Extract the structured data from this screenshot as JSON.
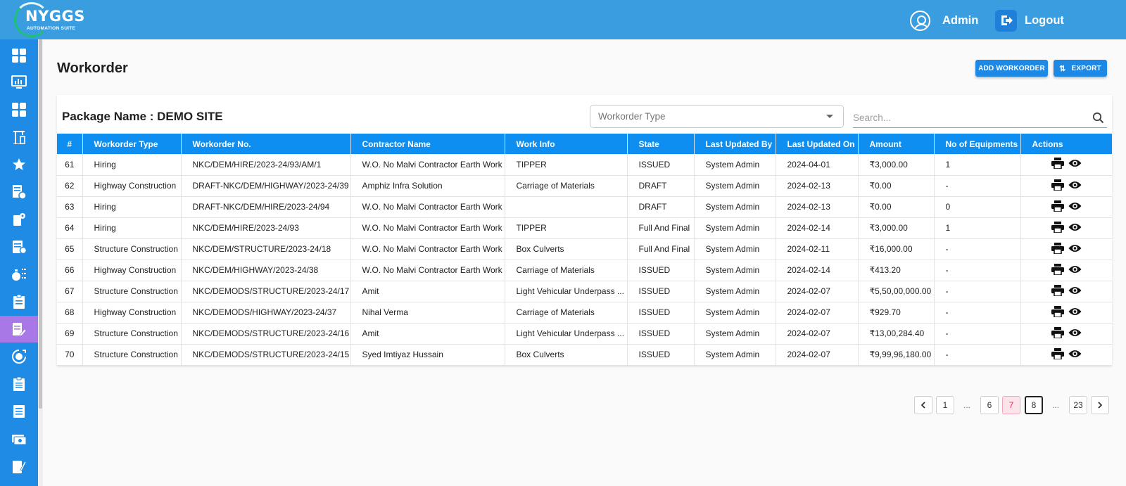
{
  "header": {
    "logo_name": "NYGGS",
    "logo_tagline": "AUTOMATION SUITE",
    "user_label": "Admin",
    "logout_label": "Logout"
  },
  "sidebar": {
    "items": [
      {
        "icon": "dashboard-icon"
      },
      {
        "icon": "monitor-chart-icon"
      },
      {
        "icon": "grid-icon"
      },
      {
        "icon": "crane-icon"
      },
      {
        "icon": "star-icon"
      },
      {
        "icon": "document-money-icon"
      },
      {
        "icon": "document-settings-icon"
      },
      {
        "icon": "clipboard-check-icon"
      },
      {
        "icon": "money-bag-list-icon"
      },
      {
        "icon": "clipboard-list-icon"
      },
      {
        "icon": "workorder-edit-icon",
        "active": true
      },
      {
        "icon": "refresh-money-icon"
      },
      {
        "icon": "clipboard-icon"
      },
      {
        "icon": "list-document-icon"
      },
      {
        "icon": "cash-icon"
      },
      {
        "icon": "report-pen-icon"
      }
    ]
  },
  "page": {
    "title": "Workorder",
    "add_button": "ADD WORKORDER",
    "export_button": "EXPORT",
    "package_name": "Package Name : DEMO SITE",
    "workorder_type_placeholder": "Workorder Type",
    "search_placeholder": "Search..."
  },
  "table": {
    "columns": [
      "#",
      "Workorder Type",
      "Workorder No.",
      "Contractor Name",
      "Work Info",
      "State",
      "Last Updated By",
      "Last Updated On",
      "Amount",
      "No of Equipments",
      "Actions"
    ],
    "rows": [
      [
        "61",
        "Hiring",
        "NKC/DEM/HIRE/2023-24/93/AM/1",
        "W.O. No Malvi Contractor Earth Work",
        "TIPPER",
        "ISSUED",
        "System Admin",
        "2024-04-01",
        "₹3,000.00",
        "1"
      ],
      [
        "62",
        "Highway Construction",
        "DRAFT-NKC/DEM/HIGHWAY/2023-24/39",
        "Amphiz Infra Solution",
        "Carriage of Materials",
        "DRAFT",
        "System Admin",
        "2024-02-13",
        "₹0.00",
        "-"
      ],
      [
        "63",
        "Hiring",
        "DRAFT-NKC/DEM/HIRE/2023-24/94",
        "W.O. No Malvi Contractor Earth Work",
        "",
        "DRAFT",
        "System Admin",
        "2024-02-13",
        "₹0.00",
        "0"
      ],
      [
        "64",
        "Hiring",
        "NKC/DEM/HIRE/2023-24/93",
        "W.O. No Malvi Contractor Earth Work",
        "TIPPER",
        "Full And Final",
        "System Admin",
        "2024-02-14",
        "₹3,000.00",
        "1"
      ],
      [
        "65",
        "Structure Construction",
        "NKC/DEM/STRUCTURE/2023-24/18",
        "W.O. No Malvi Contractor Earth Work",
        "Box Culverts",
        "Full And Final",
        "System Admin",
        "2024-02-11",
        "₹16,000.00",
        "-"
      ],
      [
        "66",
        "Highway Construction",
        "NKC/DEM/HIGHWAY/2023-24/38",
        "W.O. No Malvi Contractor Earth Work",
        "Carriage of Materials",
        "ISSUED",
        "System Admin",
        "2024-02-14",
        "₹413.20",
        "-"
      ],
      [
        "67",
        "Structure Construction",
        "NKC/DEMODS/STRUCTURE/2023-24/17",
        "Amit",
        "Light Vehicular Underpass ...",
        "ISSUED",
        "System Admin",
        "2024-02-07",
        "₹5,50,00,000.00",
        "-"
      ],
      [
        "68",
        "Highway Construction",
        "NKC/DEMODS/HIGHWAY/2023-24/37",
        "Nihal Verma",
        "Carriage of Materials",
        "ISSUED",
        "System Admin",
        "2024-02-07",
        "₹929.70",
        "-"
      ],
      [
        "69",
        "Structure Construction",
        "NKC/DEMODS/STRUCTURE/2023-24/16",
        "Amit",
        "Light Vehicular Underpass ...",
        "ISSUED",
        "System Admin",
        "2024-02-07",
        "₹13,00,284.40",
        "-"
      ],
      [
        "70",
        "Structure Construction",
        "NKC/DEMODS/STRUCTURE/2023-24/15",
        "Syed Imtiyaz Hussain",
        "Box Culverts",
        "ISSUED",
        "System Admin",
        "2024-02-07",
        "₹9,99,96,180.00",
        "-"
      ]
    ]
  },
  "pagination": {
    "prev_icon": "chevron-left-icon",
    "next_icon": "chevron-right-icon",
    "pages": [
      "1",
      "...",
      "6",
      "7",
      "8",
      "...",
      "23"
    ],
    "current": "7"
  },
  "colors": {
    "topbar": "#3a9de0",
    "sidebar": "#1f8be5",
    "sidebar_active": "#a879e6",
    "table_header": "#0d8ef0",
    "button": "#1e88e5"
  }
}
